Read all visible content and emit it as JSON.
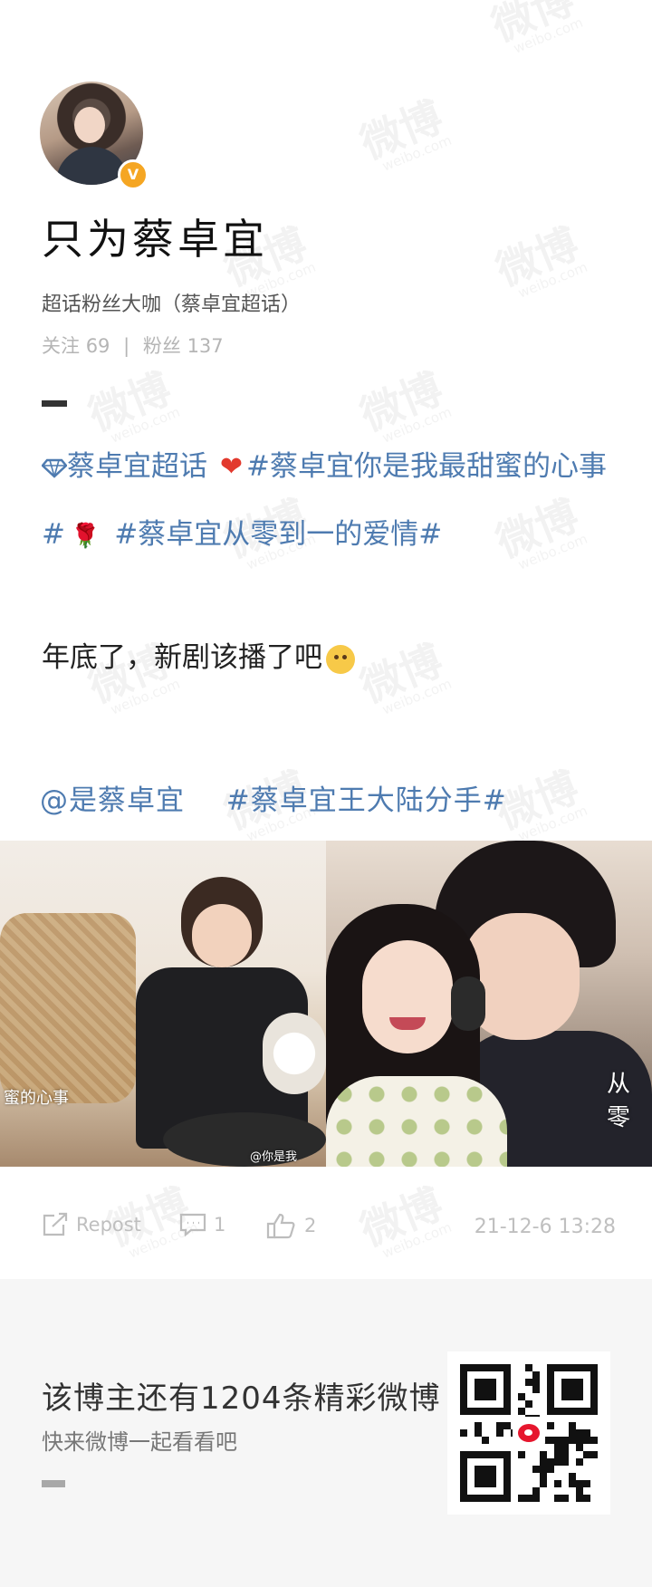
{
  "watermark": {
    "text": "微博",
    "sub": "weibo.com"
  },
  "profile": {
    "verified_mark": "V",
    "name": "只为蔡卓宜",
    "subtitle": "超话粉丝大咖（蔡卓宜超话）",
    "following_label": "关注",
    "following_count": "69",
    "separator": "|",
    "followers_label": "粉丝",
    "followers_count": "137"
  },
  "post": {
    "super_topic_icon": "diamond-icon",
    "super_topic": "蔡卓宜超话",
    "hashtag1": "#蔡卓宜你是我最甜蜜的心事#",
    "hashtag2": "#蔡卓宜从零到一的爱情#",
    "body": "年底了，新剧该播了吧",
    "mention": "@是蔡卓宜",
    "hashtag3": "#蔡卓宜王大陆分手#",
    "image1_caption": "蜜的心事",
    "image1_watermark": "@你是我",
    "image2_caption": "从零"
  },
  "actions": {
    "repost_label": "Repost",
    "comment_count": "1",
    "like_count": "2",
    "timestamp": "21-12-6 13:28"
  },
  "footer": {
    "title": "该博主还有1204条精彩微博",
    "subtitle": "快来微博一起看看吧"
  },
  "colors": {
    "link": "#4e7bb0",
    "badge": "#f5a623",
    "footer_bg": "#f6f6f6"
  }
}
